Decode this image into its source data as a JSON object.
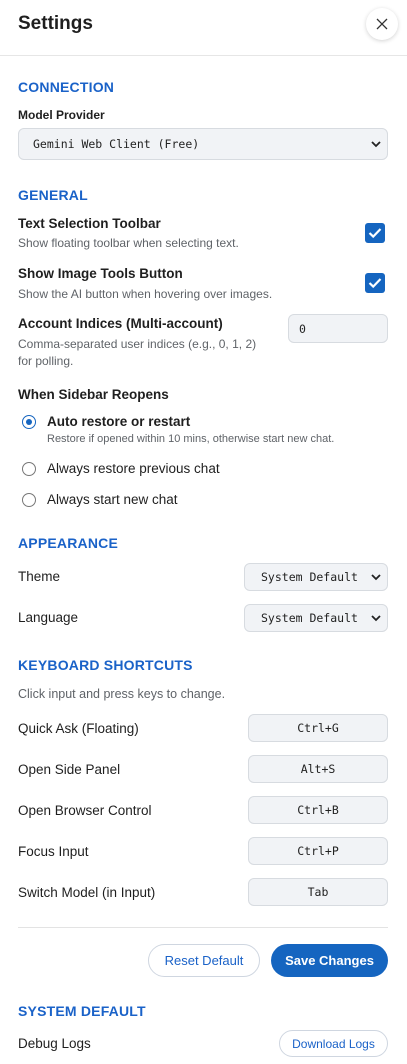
{
  "header": {
    "title": "Settings"
  },
  "connection": {
    "section_title": "CONNECTION",
    "model_provider_label": "Model Provider",
    "model_provider_value": "Gemini Web Client (Free)"
  },
  "general": {
    "section_title": "GENERAL",
    "text_selection": {
      "title": "Text Selection Toolbar",
      "desc": "Show floating toolbar when selecting text.",
      "checked": true
    },
    "image_tools": {
      "title": "Show Image Tools Button",
      "desc": "Show the AI button when hovering over images.",
      "checked": true
    },
    "account_indices": {
      "title": "Account Indices (Multi-account)",
      "desc_line1": "Comma-separated user indices (e.g., 0, 1, 2)",
      "desc_line2": "for polling.",
      "value": "0"
    },
    "sidebar_reopens": {
      "title": "When Sidebar Reopens",
      "options": [
        {
          "label": "Auto restore or restart",
          "desc": "Restore if opened within 10 mins, otherwise start new chat.",
          "selected": true
        },
        {
          "label": "Always restore previous chat",
          "selected": false
        },
        {
          "label": "Always start new chat",
          "selected": false
        }
      ]
    }
  },
  "appearance": {
    "section_title": "APPEARANCE",
    "theme_label": "Theme",
    "theme_value": "System Default",
    "language_label": "Language",
    "language_value": "System Default"
  },
  "shortcuts": {
    "section_title": "KEYBOARD SHORTCUTS",
    "hint": "Click input and press keys to change.",
    "items": [
      {
        "label": "Quick Ask (Floating)",
        "keys": "Ctrl+G"
      },
      {
        "label": "Open Side Panel",
        "keys": "Alt+S"
      },
      {
        "label": "Open Browser Control",
        "keys": "Ctrl+B"
      },
      {
        "label": "Focus Input",
        "keys": "Ctrl+P"
      },
      {
        "label": "Switch Model (in Input)",
        "keys": "Tab"
      }
    ]
  },
  "actions": {
    "reset_label": "Reset Default",
    "save_label": "Save Changes"
  },
  "system": {
    "section_title": "SYSTEM DEFAULT",
    "debug_logs_label": "Debug Logs",
    "download_logs_label": "Download Logs"
  },
  "colors": {
    "accent": "#1565c0",
    "section_title": "#1a62c8",
    "input_bg": "#f1f3f6"
  }
}
